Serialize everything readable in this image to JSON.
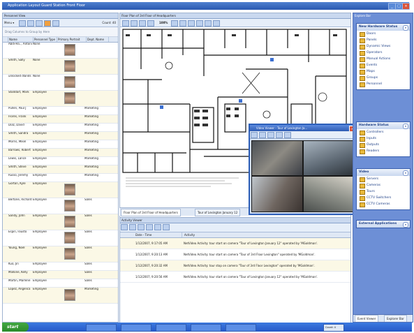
{
  "window": {
    "title": "Application Layout    Guard Station Front Floor"
  },
  "left_pane": {
    "title": "Personnel View",
    "menu_label": "Menu ▾",
    "count_label": "Count: 40",
    "group_hint": "Drag Columns to Group by Here",
    "columns": [
      "Name",
      "Personnel Type",
      "Primary Portrait",
      "Dept. Name"
    ],
    "rows": [
      {
        "name": "Abdi-Ha.., Antonio",
        "type": "None",
        "photo": true,
        "dept": ""
      },
      {
        "name": "Smith, Sally",
        "type": "None",
        "photo": true,
        "dept": ""
      },
      {
        "name": "unlocked dlands",
        "type": "None",
        "photo": true,
        "dept": ""
      },
      {
        "name": "Stoddart, Mark",
        "type": "Employee",
        "photo": true,
        "dept": ""
      },
      {
        "name": "Pullen, Paul J",
        "type": "Employee",
        "photo": false,
        "dept": "Marketing"
      },
      {
        "name": "Flores, Frank",
        "type": "Employee",
        "photo": false,
        "dept": "Marketing"
      },
      {
        "name": "Diaz, David",
        "type": "Employee",
        "photo": false,
        "dept": "Marketing"
      },
      {
        "name": "Smith, Sandra",
        "type": "Employee",
        "photo": false,
        "dept": "Marketing"
      },
      {
        "name": "Morris, Mikel",
        "type": "Employee",
        "photo": false,
        "dept": "Marketing"
      },
      {
        "name": "Barrows, Robert",
        "type": "Employee",
        "photo": false,
        "dept": "Marketing"
      },
      {
        "name": "Lewis, Lance",
        "type": "Employee",
        "photo": false,
        "dept": "Marketing"
      },
      {
        "name": "Smith, Steve",
        "type": "Employee",
        "photo": false,
        "dept": "Marketing"
      },
      {
        "name": "Russo, Jeremy",
        "type": "Employee",
        "photo": false,
        "dept": "Marketing"
      },
      {
        "name": "Gorton, Kyle",
        "type": "Employee",
        "photo": true,
        "dept": ""
      },
      {
        "name": "Bertone, Richard",
        "type": "Employee",
        "photo": true,
        "dept": "Sales"
      },
      {
        "name": "Sandy, John",
        "type": "Employee",
        "photo": true,
        "dept": "Sales"
      },
      {
        "name": "Espin, Fausto",
        "type": "Employee",
        "photo": true,
        "dept": "Sales"
      },
      {
        "name": "Young, Noel",
        "type": "Employee",
        "photo": true,
        "dept": "Sales"
      },
      {
        "name": "Kuo, Jin",
        "type": "Employee",
        "photo": false,
        "dept": "Sales"
      },
      {
        "name": "Mallone, Kelly",
        "type": "Employee",
        "photo": false,
        "dept": "Sales"
      },
      {
        "name": "Martin, Marlene",
        "type": "Employee",
        "photo": false,
        "dept": "Sales"
      },
      {
        "name": "Lopez, Angelica",
        "type": "Employee",
        "photo": true,
        "dept": "Marketing"
      }
    ]
  },
  "floor_plan": {
    "title": "Floor Plan of 3rd Floor of Headquarters",
    "zoom": "100%",
    "tabs": [
      "Floor Plan of 3rd Floor of Headquarters",
      "Tour of Lexington January 12"
    ]
  },
  "video_window": {
    "title": "Video Viewer - Tour of Lexington Ja..."
  },
  "activity": {
    "title": "Activity Viewer",
    "columns": [
      "Date - Time",
      "Activity"
    ],
    "rows": [
      {
        "time": "1/12/2007, 9:17:05 AM",
        "text": "NetVideo Activity: tour start on camera \"Tour of Lexington January 12\" operated by 'MGoldman'."
      },
      {
        "time": "1/12/2007, 9:20:13 AM",
        "text": "NetVideo Activity: tour start on camera \"Tour of 3rd Floor Lexington\" operated by 'MGoldman'."
      },
      {
        "time": "1/12/2007, 9:20:32 AM",
        "text": "NetVideo Activity: tour stop on camera \"Tour of 3rd Floor Lexington\" operated by 'MGoldman'."
      },
      {
        "time": "1/12/2007, 9:20:56 AM",
        "text": "NetVideo Activity: tour start on camera \"Tour of Lexington January 12\" operated by 'MGoldman'."
      }
    ]
  },
  "explorer": {
    "title": "Explore Bar",
    "sections": [
      {
        "title": "New Hardware Status",
        "items": [
          "Doors",
          "Panels",
          "Dynamic Views",
          "Operators",
          "Manual Actions",
          "Events",
          "Maps",
          "Groups",
          "Personnel"
        ]
      },
      {
        "title": "Hardware Status",
        "items": [
          "Controllers",
          "Inputs",
          "Outputs",
          "Readers"
        ]
      },
      {
        "title": "Video",
        "items": [
          "Servers",
          "Cameras",
          "Tours",
          "CCTV Switchers",
          "CCTV Cameras"
        ]
      },
      {
        "title": "External Applications",
        "items": []
      }
    ],
    "bottom_tabs": [
      "Event Viewer",
      "Explorer Bar"
    ]
  },
  "taskbar": {
    "start_label": "start",
    "status_count": "Count: 4"
  }
}
